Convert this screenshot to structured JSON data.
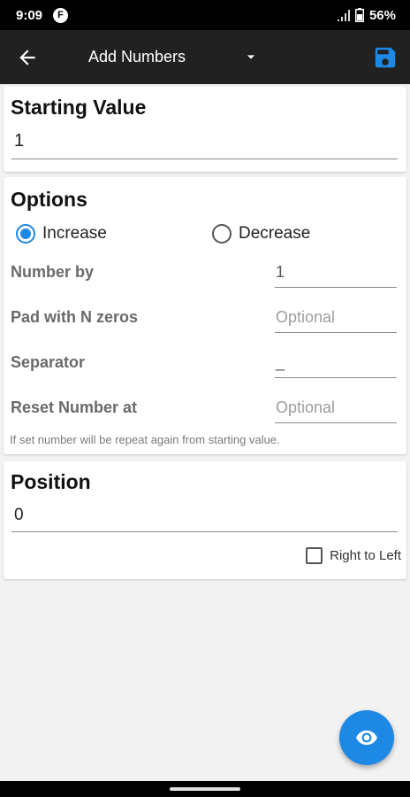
{
  "status": {
    "time": "9:09",
    "app_badge": "F",
    "battery": "56%"
  },
  "toolbar": {
    "title": "Add Numbers",
    "back_icon": "arrow-left-icon",
    "dropdown_icon": "caret-down-icon",
    "save_icon": "floppy-disk-icon",
    "accent_color": "#1e88e5"
  },
  "starting_value": {
    "title": "Starting Value",
    "value": "1"
  },
  "options": {
    "title": "Options",
    "radio_increase": "Increase",
    "radio_decrease": "Decrease",
    "selected": "Increase",
    "rows": [
      {
        "label": "Number by",
        "value": "1",
        "placeholder": ""
      },
      {
        "label": "Pad with N zeros",
        "value": "",
        "placeholder": "Optional"
      },
      {
        "label": "Separator",
        "value": "_",
        "placeholder": ""
      },
      {
        "label": "Reset Number at",
        "value": "",
        "placeholder": "Optional"
      }
    ],
    "hint": "If set number will be repeat again from starting value."
  },
  "position": {
    "title": "Position",
    "value": "0",
    "checkbox_label": "Right to Left",
    "checked": false
  },
  "fab": {
    "icon": "eye-icon"
  }
}
